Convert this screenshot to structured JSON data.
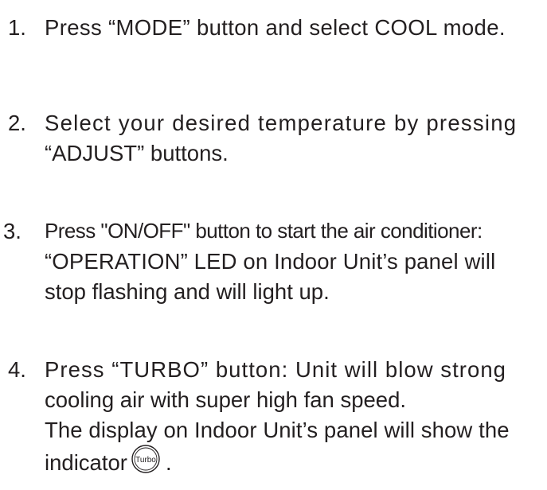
{
  "steps": [
    {
      "number": "1.",
      "lines": [
        "Press “MODE” button and select COOL mode."
      ]
    },
    {
      "number": "2.",
      "lines": [
        "Select your desired temperature by pressing",
        "“ADJUST” buttons."
      ]
    },
    {
      "number": "3.",
      "lines": [
        "Press \"ON/OFF\" button to start the air conditioner:",
        "“OPERATION” LED on Indoor Unit’s panel will",
        "stop flashing and will light up."
      ]
    },
    {
      "number": "4.",
      "lines": [
        "Press “TURBO” button: Unit will blow strong",
        "cooling air with super high fan speed.",
        "The display on Indoor Unit’s panel will show the"
      ],
      "last_line_prefix": "indicator",
      "icon_label": "Turbo",
      "last_line_suffix": "."
    }
  ]
}
